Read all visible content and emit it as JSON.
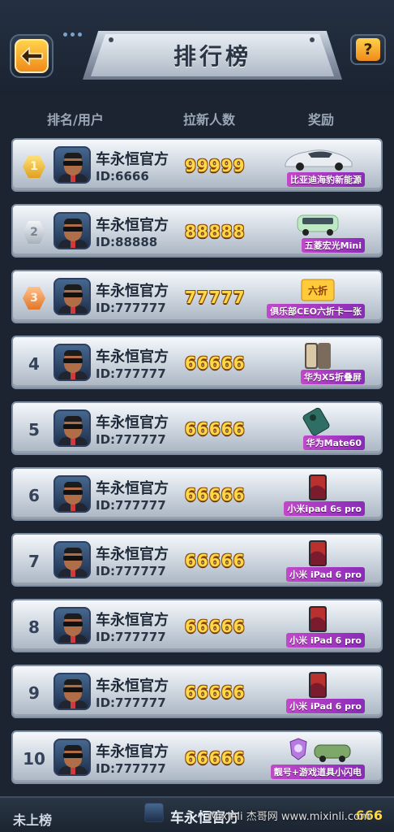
{
  "header": {
    "title": "排行榜",
    "help_label": "?"
  },
  "columns": {
    "rank_user": "排名/用户",
    "invites": "拉新人数",
    "reward": "奖励"
  },
  "rows": [
    {
      "rank": "1",
      "name": "车永恒官方",
      "id": "ID:6666",
      "count": "99999",
      "reward": "比亚迪海豹新能源",
      "reward_icon": "car-icon",
      "medal": "gold"
    },
    {
      "rank": "2",
      "name": "车永恒官方",
      "id": "ID:88888",
      "count": "88888",
      "reward": "五菱宏光Mini",
      "reward_icon": "mini-car-icon",
      "medal": "silver"
    },
    {
      "rank": "3",
      "name": "车永恒官方",
      "id": "ID:777777",
      "count": "77777",
      "reward": "俱乐部CEO六折卡一张",
      "reward_icon": "coupon-icon",
      "medal": "bronze"
    },
    {
      "rank": "4",
      "name": "车永恒官方",
      "id": "ID:777777",
      "count": "66666",
      "reward": "华为X5折叠屏",
      "reward_icon": "foldable-phone-icon",
      "medal": ""
    },
    {
      "rank": "5",
      "name": "车永恒官方",
      "id": "ID:777777",
      "count": "66666",
      "reward": "华为Mate60",
      "reward_icon": "phone-icon",
      "medal": ""
    },
    {
      "rank": "6",
      "name": "车永恒官方",
      "id": "ID:777777",
      "count": "66666",
      "reward": "小米ipad 6s pro",
      "reward_icon": "tablet-icon",
      "medal": ""
    },
    {
      "rank": "7",
      "name": "车永恒官方",
      "id": "ID:777777",
      "count": "66666",
      "reward": "小米 iPad 6 pro",
      "reward_icon": "tablet-icon",
      "medal": ""
    },
    {
      "rank": "8",
      "name": "车永恒官方",
      "id": "ID:777777",
      "count": "66666",
      "reward": "小米 iPad 6 pro",
      "reward_icon": "tablet-icon",
      "medal": ""
    },
    {
      "rank": "9",
      "name": "车永恒官方",
      "id": "ID:777777",
      "count": "66666",
      "reward": "小米 iPad 6 pro",
      "reward_icon": "tablet-icon",
      "medal": ""
    },
    {
      "rank": "10",
      "name": "车永恒官方",
      "id": "ID:777777",
      "count": "66666",
      "reward": "靓号+游戏道具小闪电",
      "reward_icon": "game-items-icon",
      "medal": ""
    }
  ],
  "footer": {
    "status": "未上榜",
    "name": "车永恒官方",
    "count": "666",
    "watermark": "Mixinli 杰哥网 www.mixinli.com"
  },
  "colors": {
    "background": "#1b2430",
    "accent": "#ffd84a",
    "reward_label": "#c248c9"
  }
}
